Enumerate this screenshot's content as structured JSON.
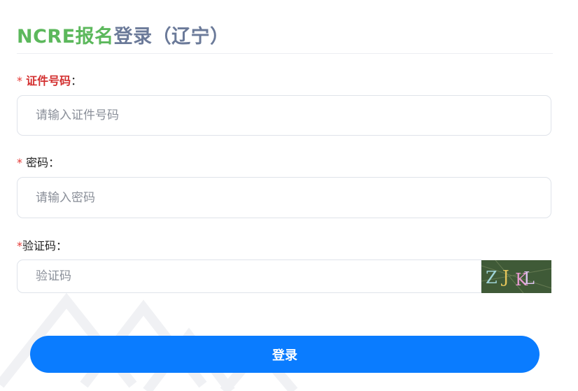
{
  "header": {
    "title_brand": "NCRE报名",
    "title_rest": "登录（辽宁）"
  },
  "form": {
    "id_number": {
      "required_mark": "*",
      "label": "证件号码",
      "colon": "：",
      "placeholder": "请输入证件号码",
      "value": ""
    },
    "password": {
      "required_mark": "*",
      "label": "密码：",
      "placeholder": "请输入密码",
      "value": ""
    },
    "captcha": {
      "required_mark": "*",
      "label": "验证码：",
      "placeholder": "验证码",
      "value": "",
      "image_text": "ZJKL"
    },
    "submit_label": "登录"
  },
  "colors": {
    "brand_green": "#5cb85c",
    "title_gray": "#6b7a99",
    "required_red": "#e53935",
    "primary_blue": "#0a7cff"
  }
}
